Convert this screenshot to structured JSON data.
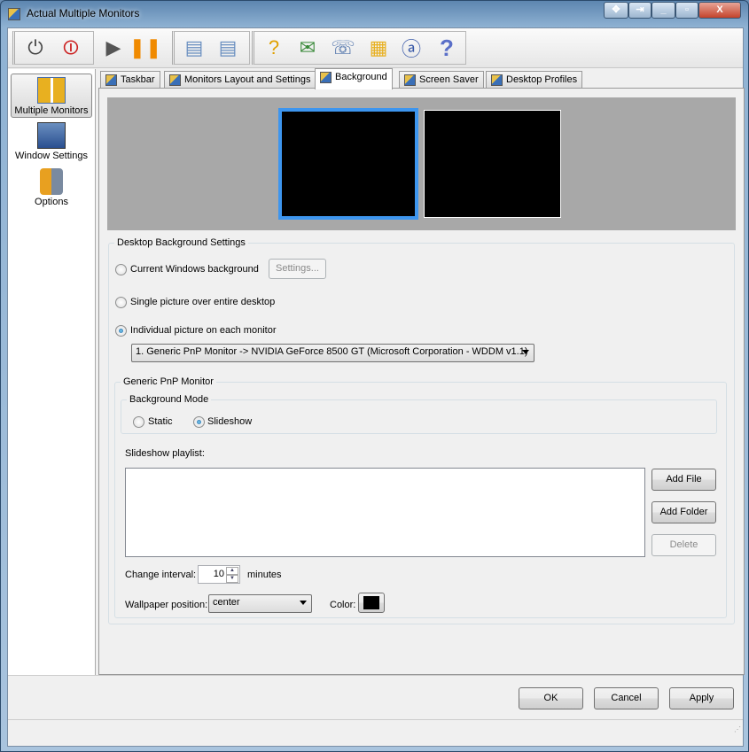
{
  "window": {
    "title": "Actual Multiple Monitors",
    "controls": [
      "move",
      "pin",
      "minimize",
      "maximize",
      "close"
    ]
  },
  "toolbar": {
    "icons": [
      "power-off-icon",
      "stop-icon",
      "play-icon",
      "pause-icon",
      "window-settings-icon",
      "user-settings-icon",
      "help-document-icon",
      "email-icon",
      "support-icon",
      "monitors-icon",
      "about-icon",
      "question-icon"
    ]
  },
  "sidebar": {
    "items": [
      {
        "label": "Multiple Monitors",
        "selected": true
      },
      {
        "label": "Window Settings"
      },
      {
        "label": "Options"
      }
    ]
  },
  "tabs": [
    {
      "label": "Taskbar"
    },
    {
      "label": "Monitors Layout and Settings"
    },
    {
      "label": "Background",
      "active": true
    },
    {
      "label": "Screen Saver"
    },
    {
      "label": "Desktop Profiles"
    }
  ],
  "background": {
    "group_title": "Desktop Background Settings",
    "options": [
      {
        "label": "Current Windows background",
        "checked": false
      },
      {
        "label": "Single picture over entire desktop",
        "checked": false
      },
      {
        "label": "Individual picture on each monitor",
        "checked": true
      }
    ],
    "settings_button": "Settings...",
    "monitor_select": "1. Generic PnP Monitor -> NVIDIA GeForce 8500 GT (Microsoft Corporation - WDDM v1.1)",
    "monitor_group": "Generic PnP Monitor",
    "mode_group": "Background Mode",
    "modes": [
      {
        "label": "Static",
        "checked": false
      },
      {
        "label": "Slideshow",
        "checked": true
      }
    ],
    "playlist_label": "Slideshow playlist:",
    "add_file": "Add File",
    "add_folder": "Add Folder",
    "delete": "Delete",
    "interval_label": "Change interval:",
    "interval_value": "10",
    "interval_unit": "minutes",
    "position_label": "Wallpaper position:",
    "position_value": "center",
    "color_label": "Color:",
    "color_value": "#000000"
  },
  "footer": {
    "ok": "OK",
    "cancel": "Cancel",
    "apply": "Apply"
  }
}
